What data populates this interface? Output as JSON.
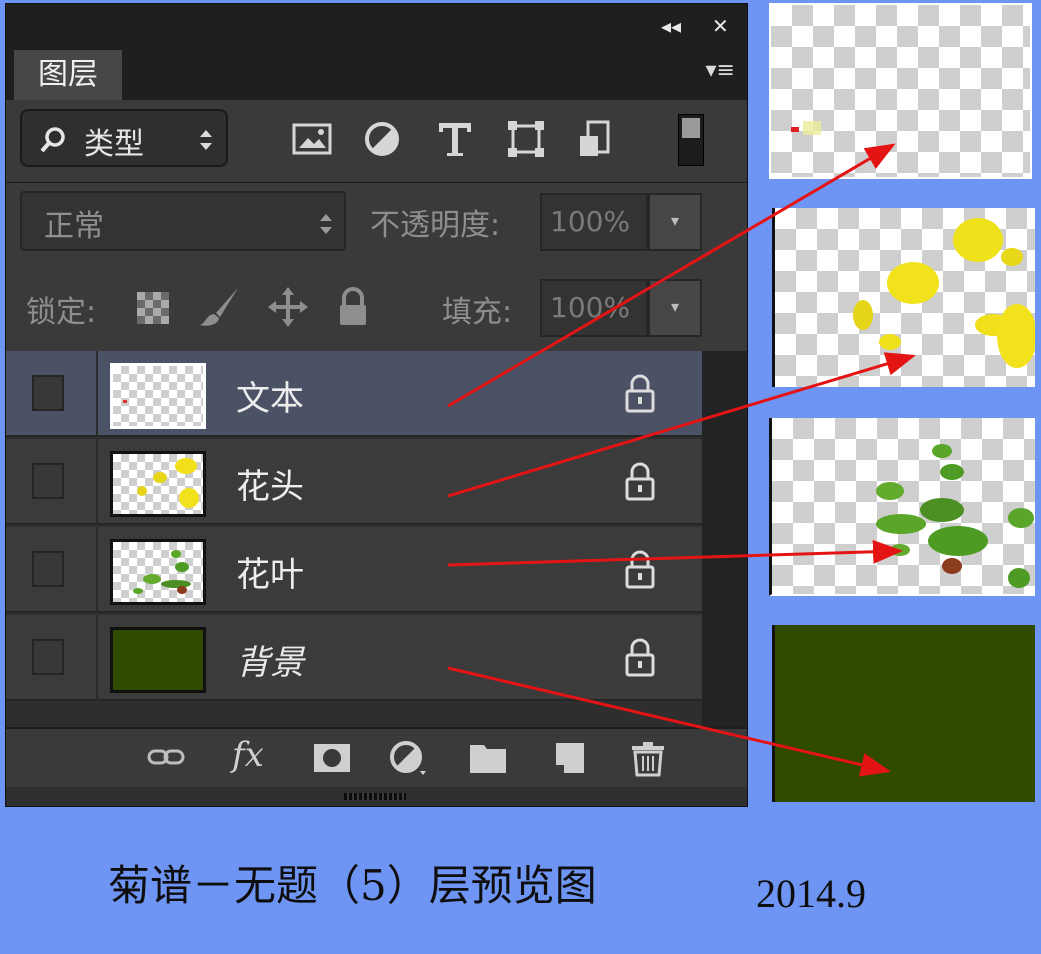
{
  "panel": {
    "collapse_icon": "double-chevron-left-icon",
    "close_icon": "close-icon",
    "tab_label": "图层",
    "menu_icon": "panel-menu-icon",
    "filter": {
      "kind_label": "类型",
      "icons": [
        "image-filter-icon",
        "adjustment-filter-icon",
        "type-filter-icon",
        "shape-filter-icon",
        "smart-object-filter-icon"
      ]
    },
    "blend_mode": "正常",
    "opacity_label": "不透明度:",
    "opacity_value": "100%",
    "lock_label": "锁定:",
    "fill_label": "填充:",
    "fill_value": "100%",
    "layers": [
      {
        "name": "文本",
        "selected": true
      },
      {
        "name": "花头",
        "selected": false
      },
      {
        "name": "花叶",
        "selected": false
      },
      {
        "name": "背景",
        "selected": false
      }
    ],
    "bottom_icons": [
      "link-icon",
      "fx-icon",
      "mask-icon",
      "adjustment-icon",
      "folder-icon",
      "new-layer-icon",
      "trash-icon"
    ],
    "fx_text": "fx"
  },
  "caption": "菊谱－无题（5）层预览图",
  "date": "2014.9",
  "colors": {
    "background": "#6f95f4",
    "panel": "#2b2b2b",
    "selected_layer": "#4b5266",
    "arrow": "#e51414",
    "bg_layer_fill": "#304a00"
  }
}
